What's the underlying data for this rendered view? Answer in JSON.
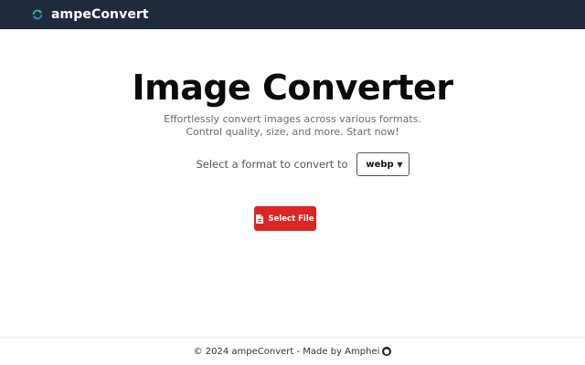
{
  "navbar": {
    "brand": "ampeConvert",
    "logo_icon": "refresh-arrows-icon",
    "background": "#1f2a3c"
  },
  "hero": {
    "title": "Image Converter",
    "subtitle_line1": "Effortlessly convert images across various formats.",
    "subtitle_line2": "Control quality, size, and more. Start now!"
  },
  "format": {
    "label": "Select a format to convert to",
    "selected": "webp"
  },
  "upload": {
    "button_label": "Select File",
    "icon": "file-icon",
    "color": "#dc2626"
  },
  "footer": {
    "text": "© 2024 ampeConvert - Made by Amphei",
    "icon": "github-icon"
  }
}
